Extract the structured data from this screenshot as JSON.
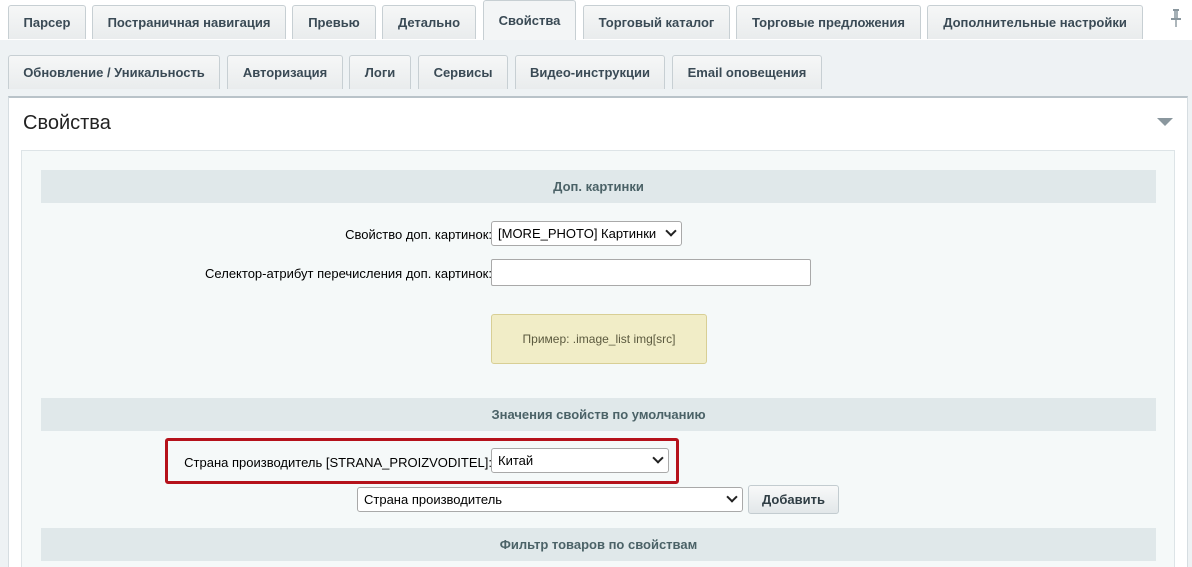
{
  "tabs_row1": [
    {
      "label": "Парсер",
      "active": false
    },
    {
      "label": "Постраничная навигация",
      "active": false
    },
    {
      "label": "Превью",
      "active": false
    },
    {
      "label": "Детально",
      "active": false
    },
    {
      "label": "Свойства",
      "active": true
    },
    {
      "label": "Торговый каталог",
      "active": false
    },
    {
      "label": "Торговые предложения",
      "active": false
    },
    {
      "label": "Дополнительные настройки",
      "active": false
    }
  ],
  "tabs_row2": [
    {
      "label": "Обновление / Уникальность"
    },
    {
      "label": "Авторизация"
    },
    {
      "label": "Логи"
    },
    {
      "label": "Сервисы"
    },
    {
      "label": "Видео-инструкции"
    },
    {
      "label": "Email оповещения"
    }
  ],
  "section": {
    "title": "Свойства"
  },
  "groups": {
    "more_photo": {
      "header": "Доп. картинки",
      "property_label": "Свойство доп. картинок:",
      "property_value": "[MORE_PHOTO] Картинки",
      "selector_label": "Селектор-атрибут перечисления доп. картинок:",
      "selector_value": "",
      "hint": "Пример: .image_list img[src]"
    },
    "defaults": {
      "header": "Значения свойств по умолчанию",
      "country_label": "Страна производитель [STRANA_PROIZVODITEL]:",
      "country_value": "Китай",
      "add_select_value": "Страна производитель",
      "add_button": "Добавить"
    },
    "filter": {
      "header": "Фильтр товаров по свойствам"
    }
  },
  "colors": {
    "highlight": "#b5121b",
    "group_header_bg": "#e0e8ea",
    "hint_bg": "#f1edc7"
  },
  "icons": {
    "pin": "pin-icon",
    "collapse": "collapse-triangle-icon"
  }
}
